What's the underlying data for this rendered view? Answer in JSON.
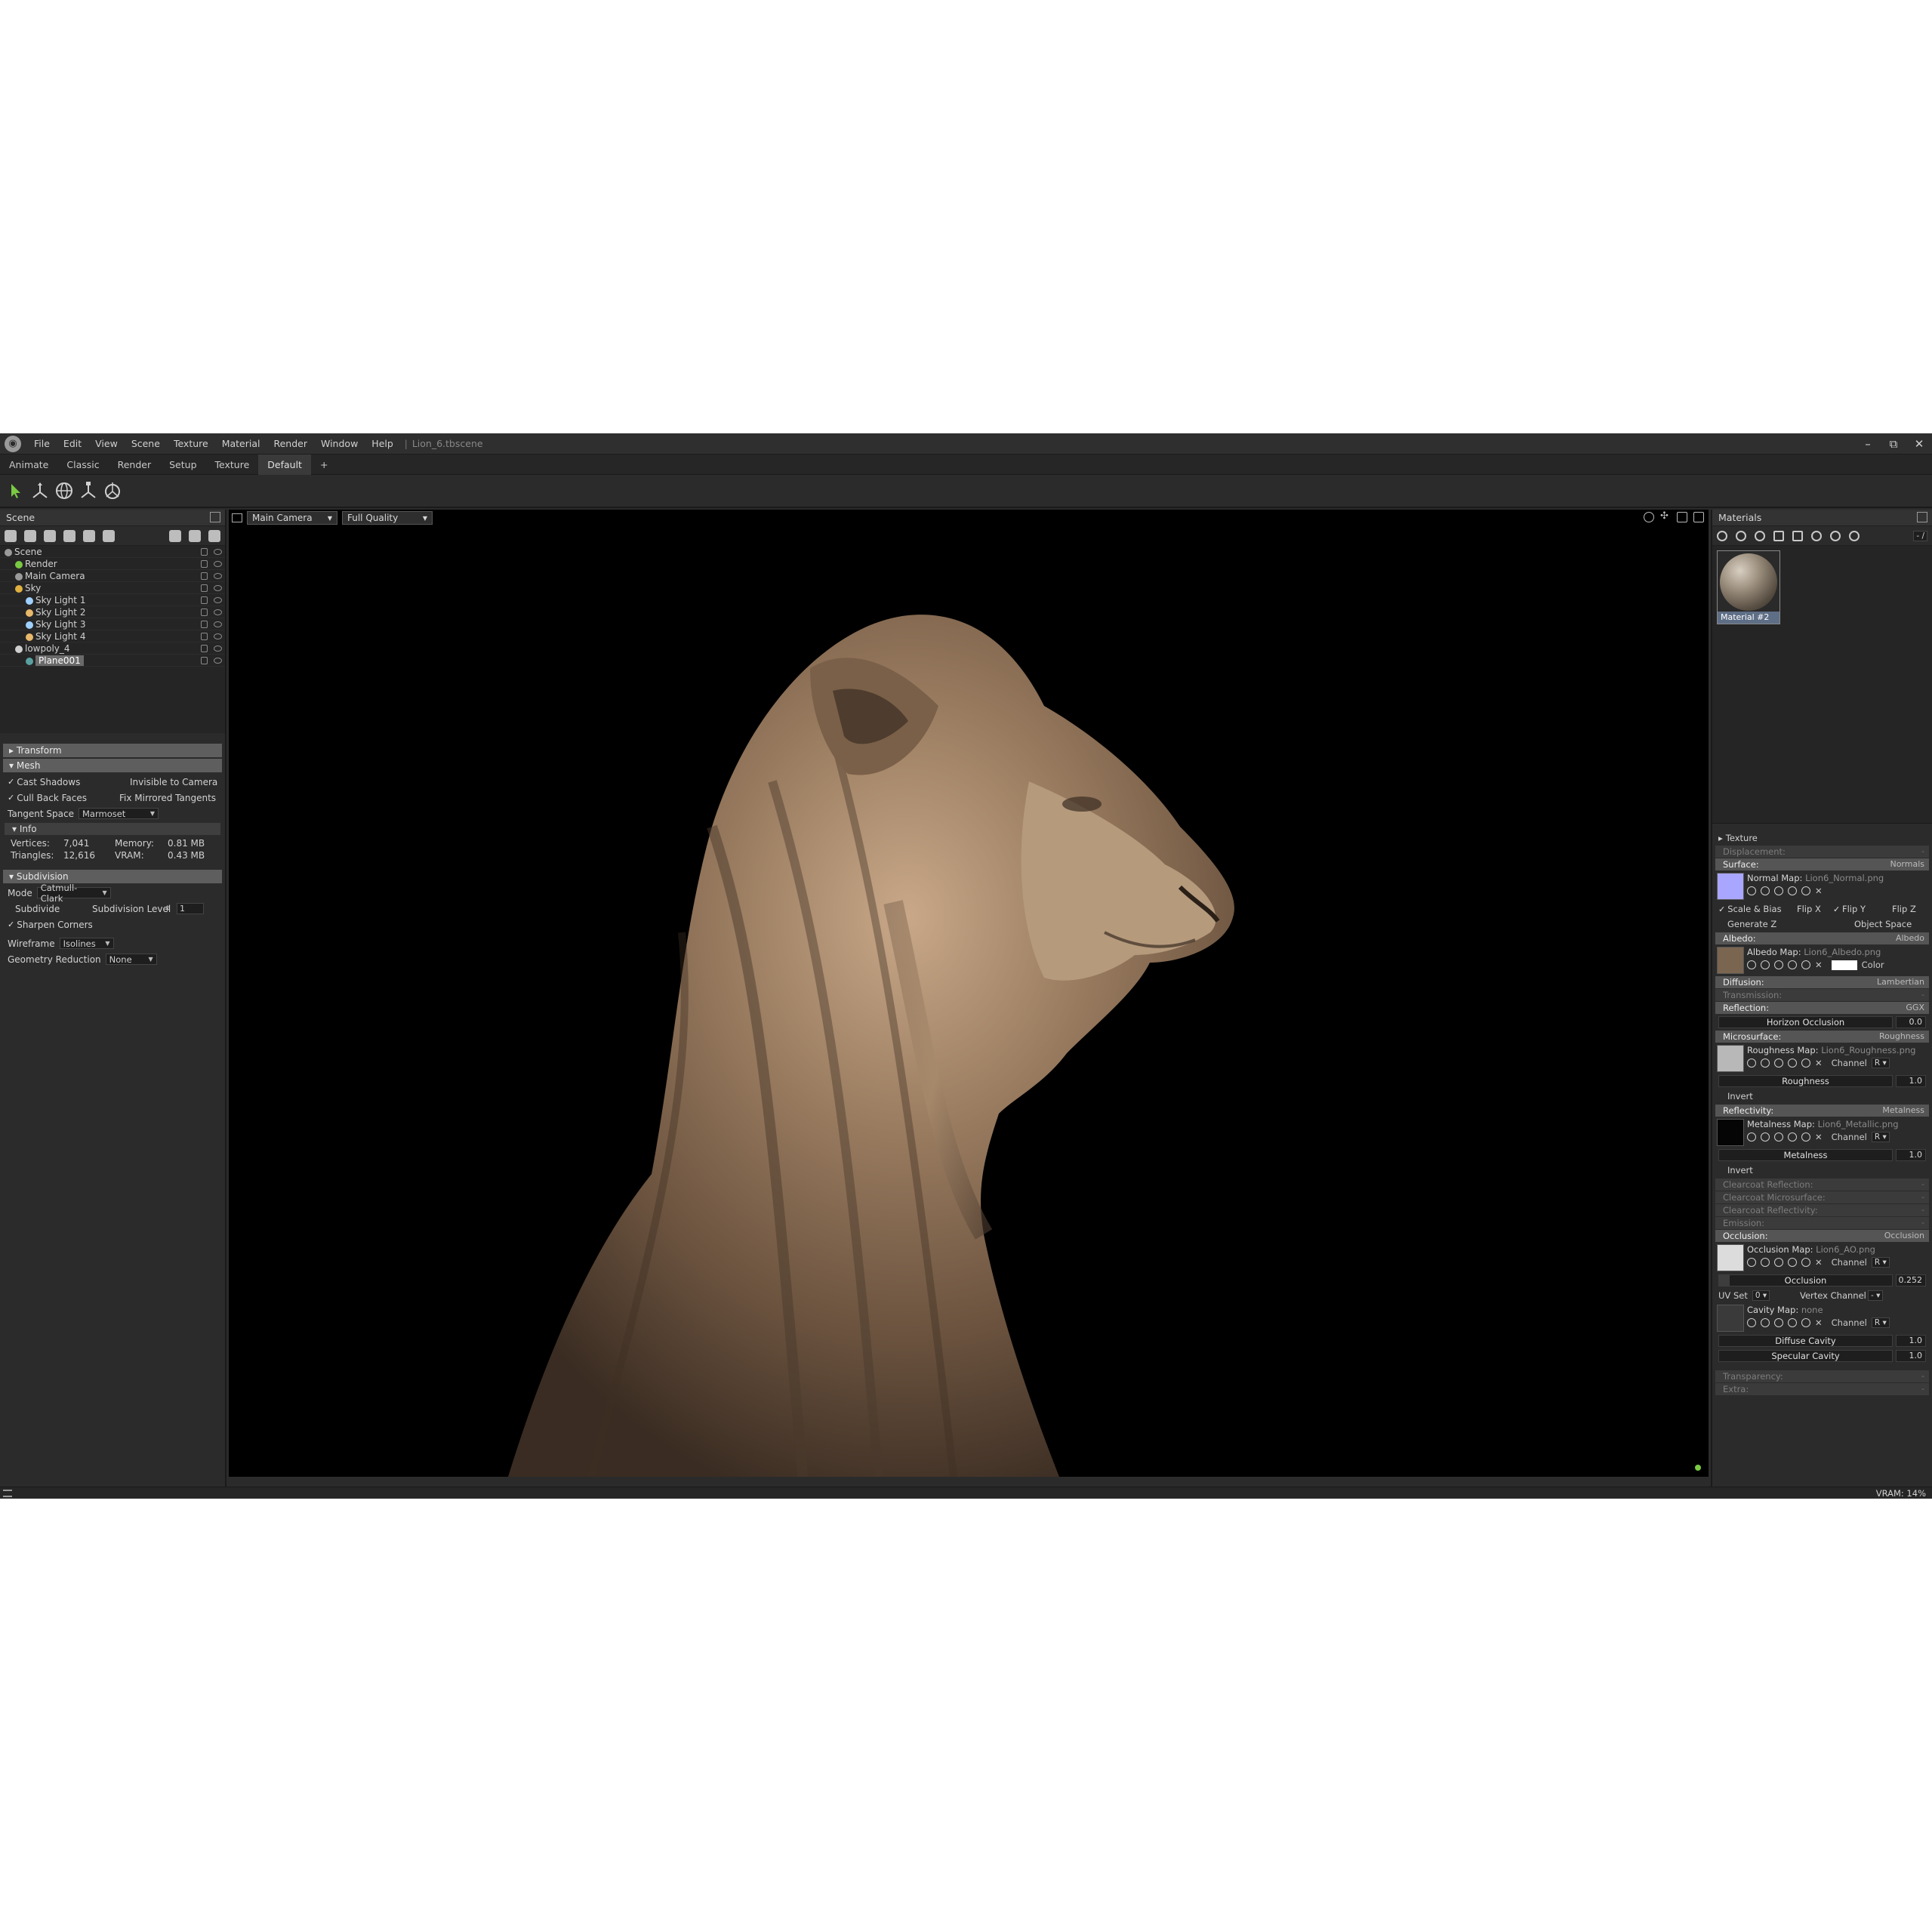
{
  "menubar": {
    "items": [
      "File",
      "Edit",
      "View",
      "Scene",
      "Texture",
      "Material",
      "Render",
      "Window",
      "Help"
    ],
    "separator": "|",
    "document_title": "Lion_6.tbscene"
  },
  "workspace_tabs": [
    "Animate",
    "Classic",
    "Render",
    "Setup",
    "Texture",
    "Default",
    "+"
  ],
  "active_tab": "Default",
  "scene_panel": {
    "title": "Scene",
    "tree": [
      {
        "label": "Scene",
        "depth": 0,
        "icon_color": "#9a9a9a"
      },
      {
        "label": "Render",
        "depth": 1,
        "icon_color": "#7ac943"
      },
      {
        "label": "Main Camera",
        "depth": 1,
        "icon_color": "#9a9a9a"
      },
      {
        "label": "Sky",
        "depth": 1,
        "icon_color": "#e0b040"
      },
      {
        "label": "Sky Light 1",
        "depth": 2,
        "icon_color": "#9fd0ff"
      },
      {
        "label": "Sky Light 2",
        "depth": 2,
        "icon_color": "#e8b86b"
      },
      {
        "label": "Sky Light 3",
        "depth": 2,
        "icon_color": "#9fd0ff"
      },
      {
        "label": "Sky Light 4",
        "depth": 2,
        "icon_color": "#e8b86b"
      },
      {
        "label": "lowpoly_4",
        "depth": 1,
        "icon_color": "#cfcfcf"
      },
      {
        "label": "Plane001",
        "depth": 2,
        "icon_color": "#5aa0a0",
        "selected": true
      }
    ]
  },
  "properties": {
    "transform": "Transform",
    "mesh": "Mesh",
    "cast_shadows": "Cast Shadows",
    "invisible_to_camera": "Invisible to Camera",
    "cull_back_faces": "Cull Back Faces",
    "fix_mirrored_tangents": "Fix Mirrored Tangents",
    "tangent_space_label": "Tangent Space",
    "tangent_space_value": "Marmoset",
    "info": "Info",
    "vertices_label": "Vertices:",
    "vertices_value": "7,041",
    "memory_label": "Memory:",
    "memory_value": "0.81 MB",
    "triangles_label": "Triangles:",
    "triangles_value": "12,616",
    "vram_label": "VRAM:",
    "vram_value": "0.43 MB",
    "subdivision": "Subdivision",
    "mode_label": "Mode",
    "mode_value": "Catmull-Clark",
    "subdivide": "Subdivide",
    "subdivision_level_label": "Subdivision Level",
    "subdivision_level_value": "1",
    "sharpen_corners": "Sharpen Corners",
    "wireframe_label": "Wireframe",
    "wireframe_value": "Isolines",
    "geometry_reduction_label": "Geometry Reduction",
    "geometry_reduction_value": "None"
  },
  "viewport": {
    "camera": "Main Camera",
    "quality": "Full Quality"
  },
  "materials_panel": {
    "title": "Materials",
    "counter": "- /",
    "material_name": "Material #2",
    "texture": "Texture",
    "displacement": "Displacement:",
    "surface": "Surface:",
    "surface_mode": "Normals",
    "normal_map_label": "Normal Map:",
    "normal_map_file": "Lion6_Normal.png",
    "scale_bias": "Scale & Bias",
    "flip_x": "Flip X",
    "flip_y": "Flip Y",
    "flip_z": "Flip Z",
    "generate_z": "Generate Z",
    "object_space": "Object Space",
    "albedo": "Albedo:",
    "albedo_mode": "Albedo",
    "albedo_map_label": "Albedo Map:",
    "albedo_map_file": "Lion6_Albedo.png",
    "color_label": "Color",
    "diffusion": "Diffusion:",
    "diffusion_mode": "Lambertian",
    "transmission": "Transmission:",
    "reflection": "Reflection:",
    "reflection_mode": "GGX",
    "horizon_occlusion": "Horizon Occlusion",
    "horizon_occlusion_value": "0.0",
    "microsurface": "Microsurface:",
    "microsurface_mode": "Roughness",
    "roughness_map_label": "Roughness Map:",
    "roughness_map_file": "Lion6_Roughness.png",
    "channel_label": "Channel",
    "channel_value": "R",
    "roughness": "Roughness",
    "roughness_value": "1.0",
    "invert": "Invert",
    "reflectivity": "Reflectivity:",
    "reflectivity_mode": "Metalness",
    "metalness_map_label": "Metalness Map:",
    "metalness_map_file": "Lion6_Metallic.png",
    "metalness": "Metalness",
    "metalness_value": "1.0",
    "clearcoat_reflection": "Clearcoat Reflection:",
    "clearcoat_microsurface": "Clearcoat Microsurface:",
    "clearcoat_reflectivity": "Clearcoat Reflectivity:",
    "emission": "Emission:",
    "occlusion": "Occlusion:",
    "occlusion_mode": "Occlusion",
    "occlusion_map_label": "Occlusion Map:",
    "occlusion_map_file": "Lion6_AO.png",
    "occlusion_slider": "Occlusion",
    "occlusion_value": "0.252",
    "uv_set_label": "UV Set",
    "uv_set_value": "0",
    "vertex_channel_label": "Vertex Channel",
    "vertex_channel_value": "-",
    "cavity_map_label": "Cavity Map:",
    "cavity_map_file": "none",
    "diffuse_cavity": "Diffuse Cavity",
    "diffuse_cavity_value": "1.0",
    "specular_cavity": "Specular Cavity",
    "specular_cavity_value": "1.0",
    "transparency": "Transparency:",
    "extra": "Extra:",
    "dash": "-"
  },
  "status": {
    "vram": "VRAM: 14%"
  },
  "colors": {
    "select_tool": "#7ac943",
    "normal_swatch": "#a9a6ff",
    "albedo_swatch": "#7a6550",
    "status_dot": "#7ac943"
  }
}
